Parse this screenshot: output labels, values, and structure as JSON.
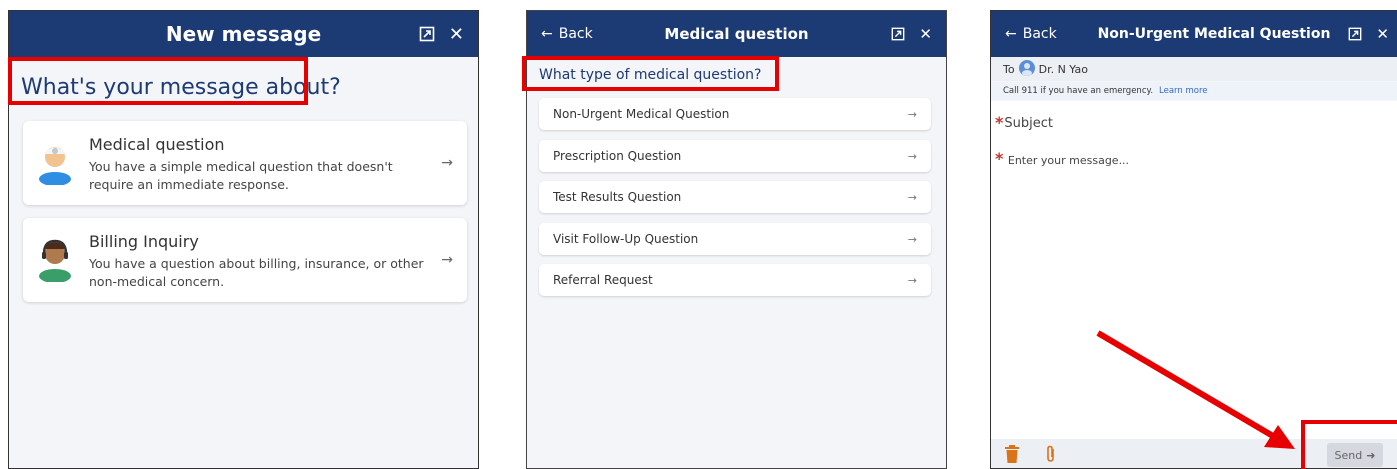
{
  "panel1": {
    "header_title": "New message",
    "question": "What's your message about?",
    "cards": [
      {
        "title": "Medical question",
        "line1": "You have a simple medical question that doesn't",
        "line2": "require an immediate response.",
        "icon": "doctor-avatar-icon"
      },
      {
        "title": "Billing Inquiry",
        "line1": "You have a question about billing, insurance, or other",
        "line2": "non-medical concern.",
        "icon": "billing-agent-avatar-icon"
      }
    ]
  },
  "panel2": {
    "back_label": "Back",
    "header_title": "Medical question",
    "question": "What type of medical question?",
    "options": [
      "Non-Urgent Medical Question",
      "Prescription Question",
      "Test Results Question",
      "Visit Follow-Up Question",
      "Referral Request"
    ]
  },
  "panel3": {
    "back_label": "Back",
    "header_title": "Non-Urgent Medical Question",
    "to_label": "To",
    "recipient": "Dr. N Yao",
    "emergency_text": "Call 911 if you have an emergency.",
    "learn_more": "Learn more",
    "subject_placeholder": "Subject",
    "message_placeholder": "Enter your message...",
    "send_label": "Send"
  },
  "common": {
    "arrow": "→",
    "back_arrow": "←",
    "close": "✕",
    "send_arrow": "➜"
  },
  "colors": {
    "header": "#1c3a73",
    "highlight": "#e60000",
    "required": "#c0392b",
    "trash": "#d9731a"
  }
}
